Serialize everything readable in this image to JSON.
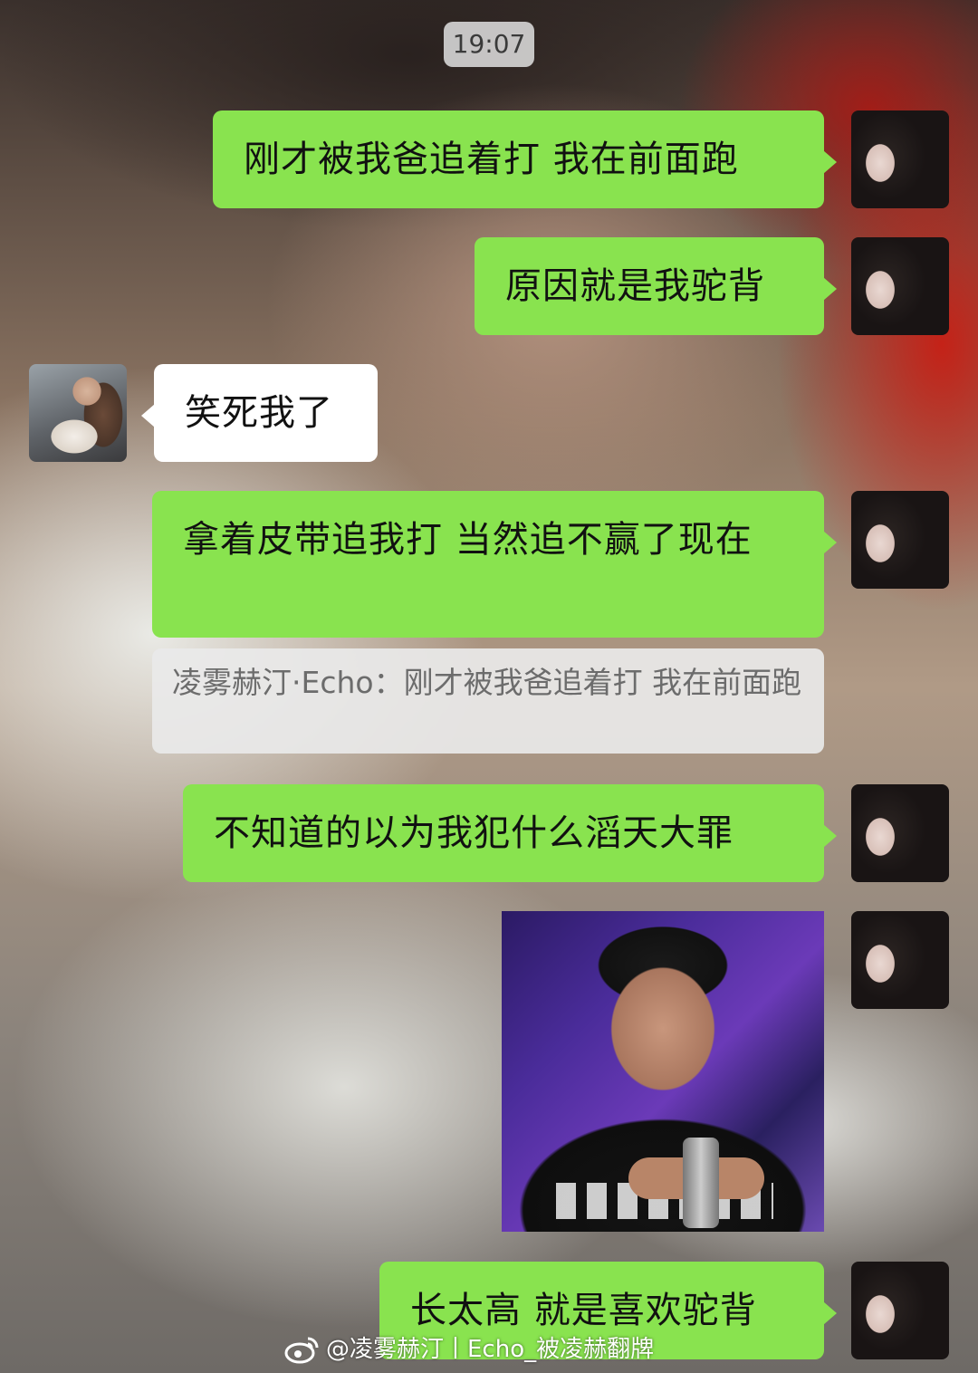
{
  "timestamp": "19:07",
  "messages": [
    {
      "from": "me",
      "text": "刚才被我爸追着打 我在前面跑"
    },
    {
      "from": "me",
      "text": "原因就是我驼背"
    },
    {
      "from": "other",
      "text": "笑死我了"
    },
    {
      "from": "me",
      "text": "拿着皮带追我打 当然追不赢了现在"
    },
    {
      "from": "me",
      "text": "不知道的以为我犯什么滔天大罪"
    },
    {
      "from": "me",
      "type": "sticker",
      "sticker": "crying-man-sticker"
    },
    {
      "from": "me",
      "text": "长太高 就是喜欢驼背"
    }
  ],
  "quote": {
    "text": "凌雾赫汀·Echo：刚才被我爸追着打 我在前面跑"
  },
  "watermark": {
    "text": "@凌雾赫汀丨Echo_被凌赫翻牌",
    "icon": "weibo-icon"
  },
  "colors": {
    "my_bubble": "#89e34f",
    "other_bubble": "#ffffff",
    "quote_bg": "#e9e9e9"
  }
}
